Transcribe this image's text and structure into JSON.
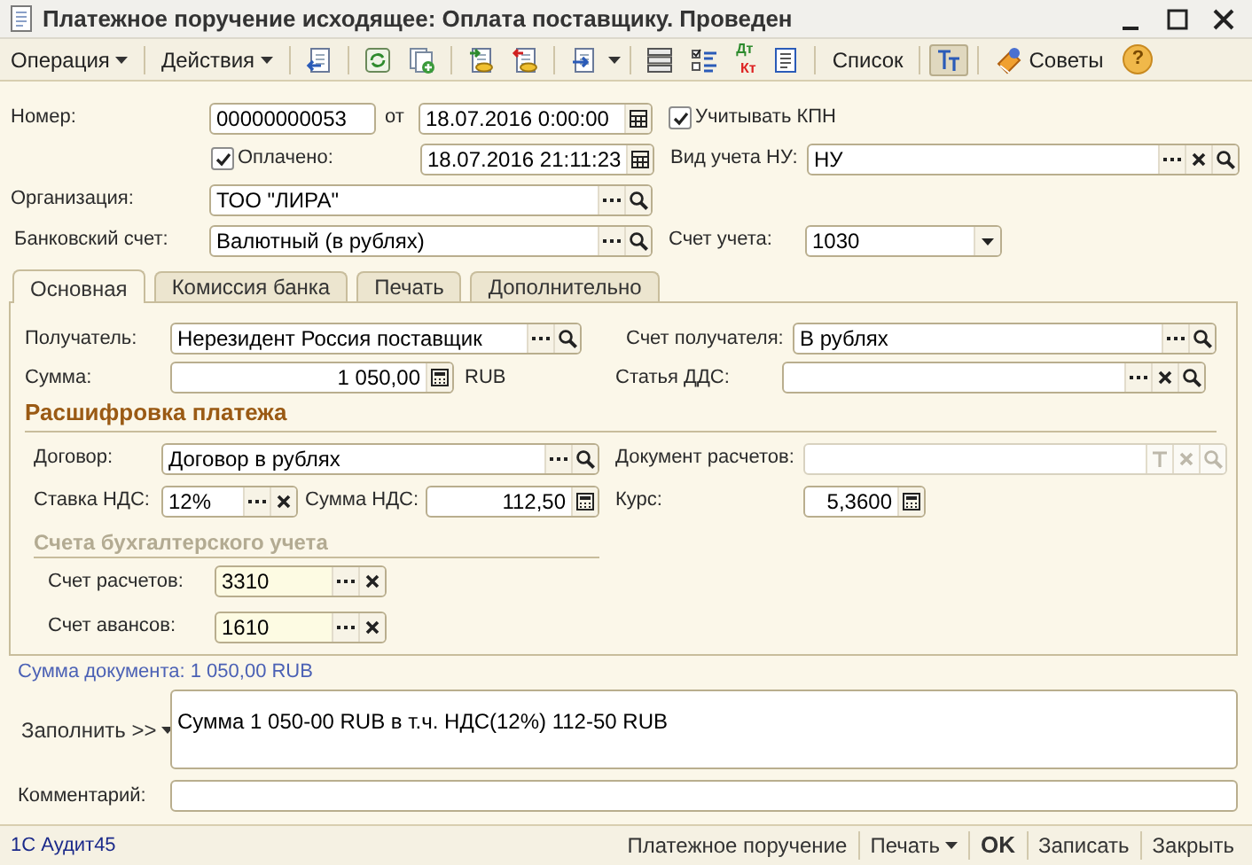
{
  "window": {
    "title": "Платежное поручение исходящее: Оплата поставщику. Проведен"
  },
  "toolbar": {
    "menus": [
      {
        "label": "Операция"
      },
      {
        "label": "Действия"
      }
    ],
    "ledger_button": {
      "debit": "Дт",
      "credit": "Кт"
    },
    "list_button": "Список",
    "filter_toggle": {
      "pressed": true
    },
    "tips_button": "Советы",
    "help_button": "?"
  },
  "header": {
    "number": {
      "label": "Номер:",
      "value": "00000000053"
    },
    "date": {
      "label": "от",
      "value": "18.07.2016  0:00:00"
    },
    "kpn": {
      "label": "Учитывать КПН",
      "checked": true
    },
    "paid": {
      "label": "Оплачено:",
      "checked": true,
      "value": "18.07.2016 21:11:23"
    },
    "tax_type": {
      "label": "Вид учета НУ:",
      "value": "НУ",
      "actions": [
        {
          "kind": "choose"
        },
        {
          "kind": "clear"
        },
        {
          "kind": "search"
        }
      ]
    },
    "organization": {
      "label": "Организация:",
      "value": "ТОО \"ЛИРА\"",
      "actions": [
        {
          "kind": "choose"
        },
        {
          "kind": "search"
        }
      ]
    },
    "bank_account": {
      "label": "Банковский счет:",
      "value": "Валютный (в рублях)",
      "actions": [
        {
          "kind": "choose"
        },
        {
          "kind": "search"
        }
      ]
    },
    "ledger_account": {
      "label": "Счет учета:",
      "value": "1030",
      "actions": [
        {
          "kind": "dropdown"
        }
      ]
    }
  },
  "tabs": [
    {
      "label": "Основная",
      "selected": true
    },
    {
      "label": "Комиссия банка",
      "selected": false
    },
    {
      "label": "Печать",
      "selected": false
    },
    {
      "label": "Дополнительно",
      "selected": false
    }
  ],
  "main": {
    "recipient": {
      "label": "Получатель:",
      "value": "Нерезидент Россия поставщик",
      "actions": [
        {
          "kind": "choose"
        },
        {
          "kind": "search"
        }
      ]
    },
    "recipient_account": {
      "label": "Счет получателя:",
      "value": "В рублях",
      "actions": [
        {
          "kind": "choose"
        },
        {
          "kind": "search"
        }
      ]
    },
    "amount": {
      "label": "Сумма:",
      "value": "1 050,00",
      "actions": [
        {
          "kind": "calculator"
        }
      ],
      "currency": "RUB"
    },
    "cash_flow_item": {
      "label": "Статья ДДС:",
      "actions": [
        {
          "kind": "choose"
        },
        {
          "kind": "clear"
        },
        {
          "kind": "search"
        }
      ]
    },
    "breakdown_title": "Расшифровка платежа",
    "contract": {
      "label": "Договор:",
      "value": "Договор в рублях",
      "actions": [
        {
          "kind": "choose"
        },
        {
          "kind": "search"
        }
      ]
    },
    "settlement_document": {
      "label": "Документ расчетов:",
      "disabled": true,
      "actions": [
        {
          "kind": "text"
        },
        {
          "kind": "clear"
        },
        {
          "kind": "search"
        }
      ]
    },
    "vat_rate": {
      "label": "Ставка НДС:",
      "value": "12%",
      "actions": [
        {
          "kind": "choose"
        },
        {
          "kind": "clear"
        }
      ]
    },
    "vat_amount": {
      "label": "Сумма НДС:",
      "value": "112,50",
      "actions": [
        {
          "kind": "calculator"
        }
      ]
    },
    "rate": {
      "label": "Курс:",
      "value": "5,3600",
      "actions": [
        {
          "kind": "calculator"
        }
      ]
    },
    "accounts_title": "Счета бухгалтерского учета",
    "accounts": [
      {
        "label": "Счет расчетов:",
        "value": "3310",
        "actions": [
          {
            "kind": "choose"
          },
          {
            "kind": "clear"
          }
        ]
      },
      {
        "label": "Счет авансов:",
        "value": "1610",
        "actions": [
          {
            "kind": "choose"
          },
          {
            "kind": "clear"
          }
        ]
      }
    ]
  },
  "document_total": "Сумма документа: 1 050,00 RUB",
  "fill_button": "Заполнить >>",
  "purpose": "Сумма 1 050-00 RUB в т.ч. НДС(12%) 112-50 RUB",
  "comment": {
    "label": "Комментарий:"
  },
  "status_bar": {
    "left": "1С Аудит45",
    "buttons": [
      {
        "label": "Платежное поручение",
        "kind": "plain"
      },
      {
        "label": "Печать",
        "kind": "menu"
      },
      {
        "label": "OK",
        "kind": "default"
      },
      {
        "label": "Записать",
        "kind": "plain"
      },
      {
        "label": "Закрыть",
        "kind": "plain"
      }
    ]
  }
}
